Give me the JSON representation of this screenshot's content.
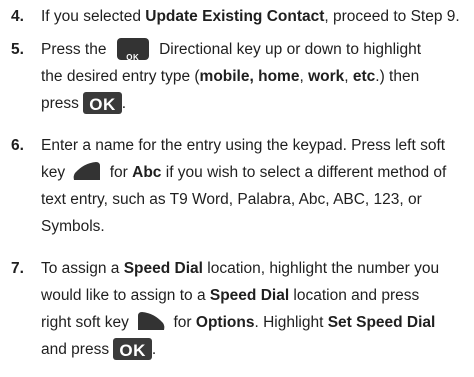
{
  "steps": [
    {
      "number": "4.",
      "lines": [
        [
          {
            "t": "If you selected "
          },
          {
            "t": "Update Existing Contact",
            "b": true
          },
          {
            "t": ", proceed to Step 9."
          }
        ]
      ]
    },
    {
      "number": "5.",
      "lines": [
        [
          {
            "t": "Press the "
          },
          {
            "icon": "directional-ok-key-icon",
            "label": "OK"
          },
          {
            "t": " Directional key up or down to highlight"
          }
        ],
        [
          {
            "t": "the desired entry type ("
          },
          {
            "t": "mobile, home",
            "b": true
          },
          {
            "t": ", "
          },
          {
            "t": "work",
            "b": true
          },
          {
            "t": ", "
          },
          {
            "t": "etc",
            "b": true
          },
          {
            "t": ".) then"
          }
        ],
        [
          {
            "t": "press "
          },
          {
            "icon": "ok-key-icon",
            "label": "OK"
          },
          {
            "t": "."
          }
        ]
      ]
    },
    {
      "number": "6.",
      "lines": [
        [
          {
            "t": "Enter a name for the entry using the keypad. Press left soft"
          }
        ],
        [
          {
            "t": "key "
          },
          {
            "icon": "left-soft-key-icon"
          },
          {
            "t": " for "
          },
          {
            "t": "Abc",
            "b": true
          },
          {
            "t": " if you wish to select a different method of"
          }
        ],
        [
          {
            "t": "text entry, such as T9 Word, Palabra, Abc, ABC, 123, or"
          }
        ],
        [
          {
            "t": "Symbols."
          }
        ]
      ]
    },
    {
      "number": "7.",
      "lines": [
        [
          {
            "t": "To assign a "
          },
          {
            "t": "Speed Dial",
            "b": true
          },
          {
            "t": " location, highlight the number you"
          }
        ],
        [
          {
            "t": "would like to assign to a "
          },
          {
            "t": "Speed Dial",
            "b": true
          },
          {
            "t": " location and press"
          }
        ],
        [
          {
            "t": "right soft key "
          },
          {
            "icon": "right-soft-key-icon"
          },
          {
            "t": " for "
          },
          {
            "t": "Options",
            "b": true
          },
          {
            "t": ". Highlight "
          },
          {
            "t": "Set Speed Dial",
            "b": true
          }
        ],
        [
          {
            "t": "and press "
          },
          {
            "icon": "ok-key-icon",
            "label": "OK"
          },
          {
            "t": "."
          }
        ]
      ]
    }
  ]
}
